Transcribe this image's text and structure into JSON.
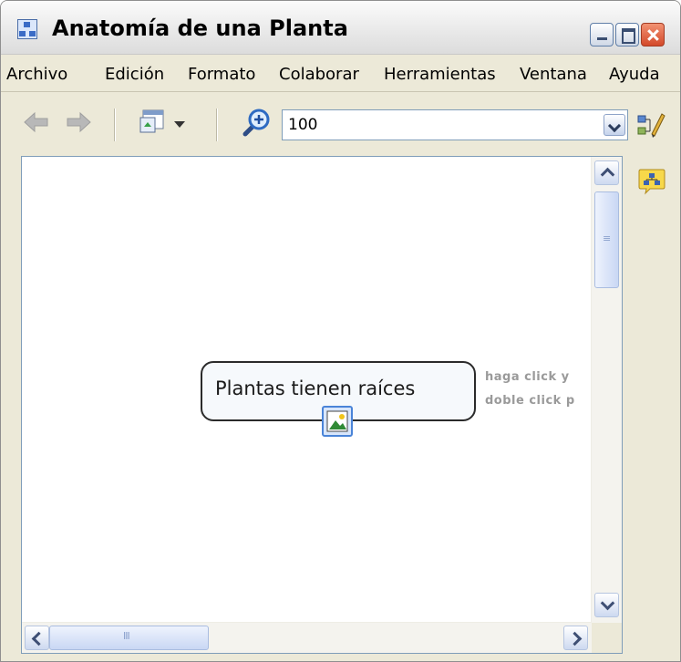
{
  "window": {
    "title": "Anatomía de una Planta"
  },
  "menu": [
    "Archivo",
    "Edición",
    "Formato",
    "Colaborar",
    "Herramientas",
    "Ventana",
    "Ayuda"
  ],
  "toolbar": {
    "zoom_value": "100"
  },
  "map": {
    "central_topic": "Plantas tienen raíces",
    "hint_line_1": "haga click y",
    "hint_line_2": "doble click p"
  },
  "scrollbars": {
    "horizontal_grip": "III",
    "vertical_grip": "≡"
  }
}
